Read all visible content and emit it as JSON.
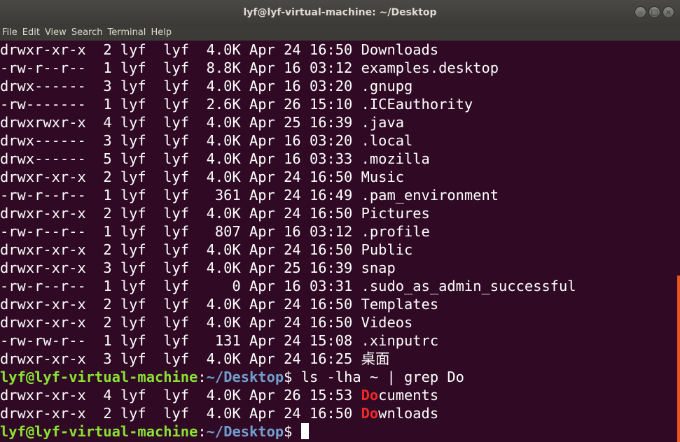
{
  "window": {
    "title": "lyf@lyf-virtual-machine: ~/Desktop"
  },
  "menu": [
    "File",
    "Edit",
    "View",
    "Search",
    "Terminal",
    "Help"
  ],
  "terminal": {
    "listing": [
      {
        "perm": "drwxr-xr-x",
        "links": "2",
        "user": "lyf",
        "group": "lyf",
        "size": "4.0K",
        "date": "Apr 24 16:50",
        "name": "Downloads"
      },
      {
        "perm": "-rw-r--r--",
        "links": "1",
        "user": "lyf",
        "group": "lyf",
        "size": "8.8K",
        "date": "Apr 16 03:12",
        "name": "examples.desktop"
      },
      {
        "perm": "drwx------",
        "links": "3",
        "user": "lyf",
        "group": "lyf",
        "size": "4.0K",
        "date": "Apr 16 03:20",
        "name": ".gnupg"
      },
      {
        "perm": "-rw-------",
        "links": "1",
        "user": "lyf",
        "group": "lyf",
        "size": "2.6K",
        "date": "Apr 26 15:10",
        "name": ".ICEauthority"
      },
      {
        "perm": "drwxrwxr-x",
        "links": "4",
        "user": "lyf",
        "group": "lyf",
        "size": "4.0K",
        "date": "Apr 25 16:39",
        "name": ".java"
      },
      {
        "perm": "drwx------",
        "links": "3",
        "user": "lyf",
        "group": "lyf",
        "size": "4.0K",
        "date": "Apr 16 03:20",
        "name": ".local"
      },
      {
        "perm": "drwx------",
        "links": "5",
        "user": "lyf",
        "group": "lyf",
        "size": "4.0K",
        "date": "Apr 16 03:33",
        "name": ".mozilla"
      },
      {
        "perm": "drwxr-xr-x",
        "links": "2",
        "user": "lyf",
        "group": "lyf",
        "size": "4.0K",
        "date": "Apr 24 16:50",
        "name": "Music"
      },
      {
        "perm": "-rw-r--r--",
        "links": "1",
        "user": "lyf",
        "group": "lyf",
        "size": "361",
        "date": "Apr 24 16:49",
        "name": ".pam_environment"
      },
      {
        "perm": "drwxr-xr-x",
        "links": "2",
        "user": "lyf",
        "group": "lyf",
        "size": "4.0K",
        "date": "Apr 24 16:50",
        "name": "Pictures"
      },
      {
        "perm": "-rw-r--r--",
        "links": "1",
        "user": "lyf",
        "group": "lyf",
        "size": "807",
        "date": "Apr 16 03:12",
        "name": ".profile"
      },
      {
        "perm": "drwxr-xr-x",
        "links": "2",
        "user": "lyf",
        "group": "lyf",
        "size": "4.0K",
        "date": "Apr 24 16:50",
        "name": "Public"
      },
      {
        "perm": "drwxr-xr-x",
        "links": "3",
        "user": "lyf",
        "group": "lyf",
        "size": "4.0K",
        "date": "Apr 25 16:39",
        "name": "snap"
      },
      {
        "perm": "-rw-r--r--",
        "links": "1",
        "user": "lyf",
        "group": "lyf",
        "size": "0",
        "date": "Apr 16 03:31",
        "name": ".sudo_as_admin_successful"
      },
      {
        "perm": "drwxr-xr-x",
        "links": "2",
        "user": "lyf",
        "group": "lyf",
        "size": "4.0K",
        "date": "Apr 24 16:50",
        "name": "Templates"
      },
      {
        "perm": "drwxr-xr-x",
        "links": "2",
        "user": "lyf",
        "group": "lyf",
        "size": "4.0K",
        "date": "Apr 24 16:50",
        "name": "Videos"
      },
      {
        "perm": "-rw-rw-r--",
        "links": "1",
        "user": "lyf",
        "group": "lyf",
        "size": "131",
        "date": "Apr 24 15:08",
        "name": ".xinputrc"
      },
      {
        "perm": "drwxr-xr-x",
        "links": "3",
        "user": "lyf",
        "group": "lyf",
        "size": "4.0K",
        "date": "Apr 24 16:25",
        "name": "桌面"
      }
    ],
    "prompt": {
      "user_host": "lyf@lyf-virtual-machine",
      "colon": ":",
      "path": "~/Desktop",
      "symbol": "$"
    },
    "command": " ls -lha ~ | grep Do",
    "grep_results": [
      {
        "perm": "drwxr-xr-x",
        "links": "4",
        "user": "lyf",
        "group": "lyf",
        "size": "4.0K",
        "date": "Apr 26 15:53",
        "match": "Do",
        "rest": "cuments"
      },
      {
        "perm": "drwxr-xr-x",
        "links": "2",
        "user": "lyf",
        "group": "lyf",
        "size": "4.0K",
        "date": "Apr 24 16:50",
        "match": "Do",
        "rest": "wnloads"
      }
    ]
  },
  "colors": {
    "terminal_bg": "#300a24",
    "prompt_user": "#8ae234",
    "prompt_path": "#729fcf",
    "grep_match": "#ef2929",
    "scrollbar": "#e95420"
  }
}
